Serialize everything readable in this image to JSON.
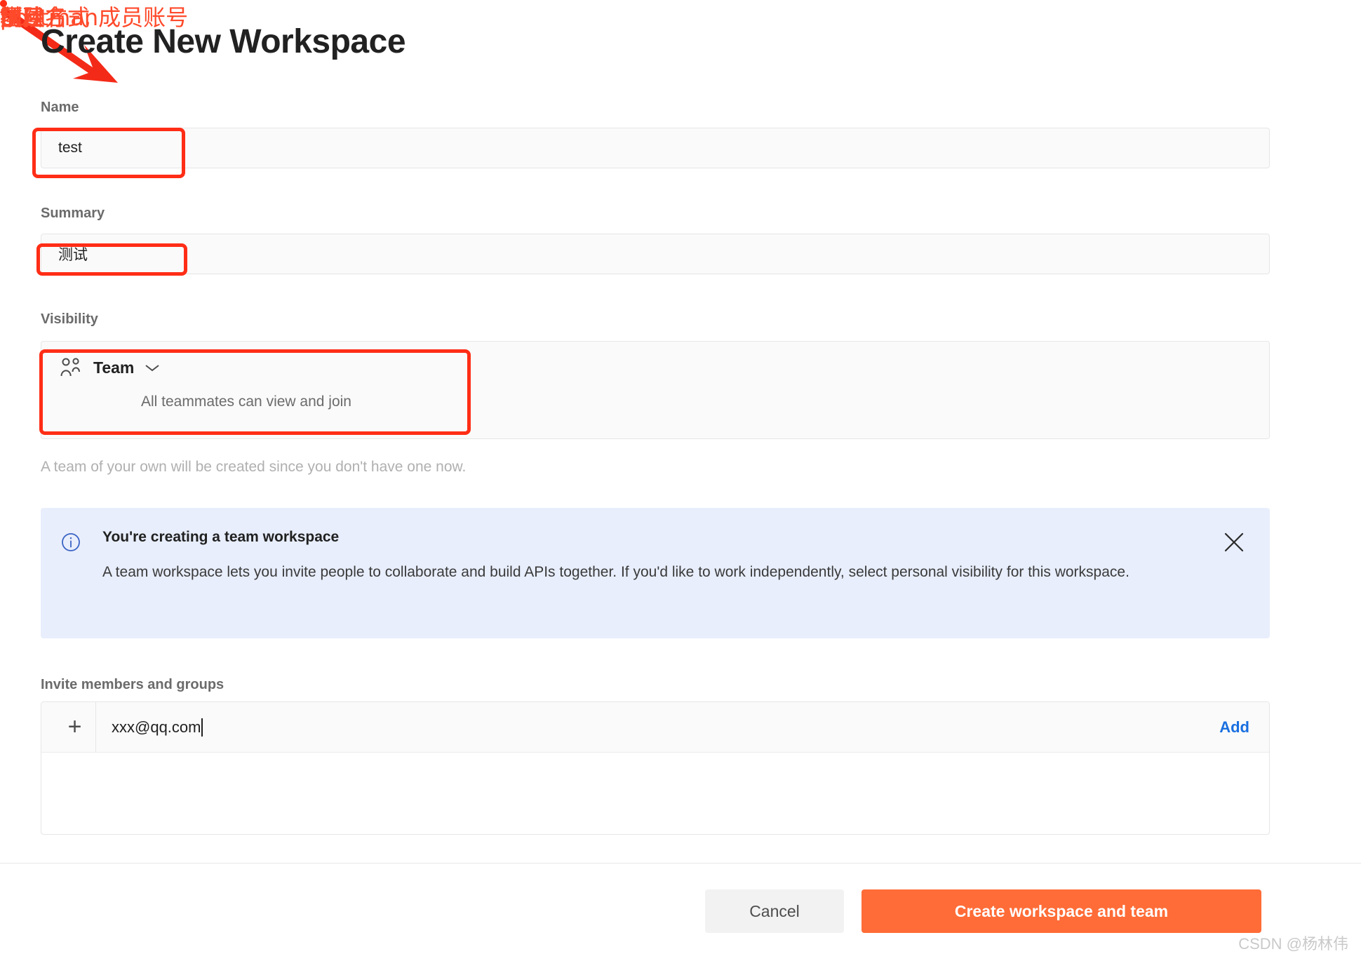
{
  "page": {
    "title": "Create New Workspace"
  },
  "form": {
    "name": {
      "label": "Name",
      "value": "test"
    },
    "summary": {
      "label": "Summary",
      "value": "测试"
    },
    "visibility": {
      "label": "Visibility",
      "selected": "Team",
      "description": "All teammates can view and join",
      "helper": "A team of your own will be created since you don't have one now."
    },
    "invite": {
      "label": "Invite members and groups",
      "plus": "+",
      "email": "xxx@qq.com",
      "add_label": "Add"
    }
  },
  "banner": {
    "title": "You're creating a team workspace",
    "body": "A team workspace lets you invite people to collaborate and build APIs together. If you'd like to work independently, select personal visibility for this workspace."
  },
  "footer": {
    "cancel_label": "Cancel",
    "create_label": "Create workspace and team"
  },
  "watermark": "CSDN @杨林伟",
  "annotations": {
    "name": "项目名",
    "summary": "描述",
    "visibility": "团队方式",
    "invite": "postman成员账号",
    "create": "创建"
  },
  "colors": {
    "accent": "#ff6c37",
    "annotation": "#ff4a2b",
    "annotation_box": "#ff2d16",
    "link": "#1a6fe0",
    "banner_bg": "#e8eefc"
  }
}
